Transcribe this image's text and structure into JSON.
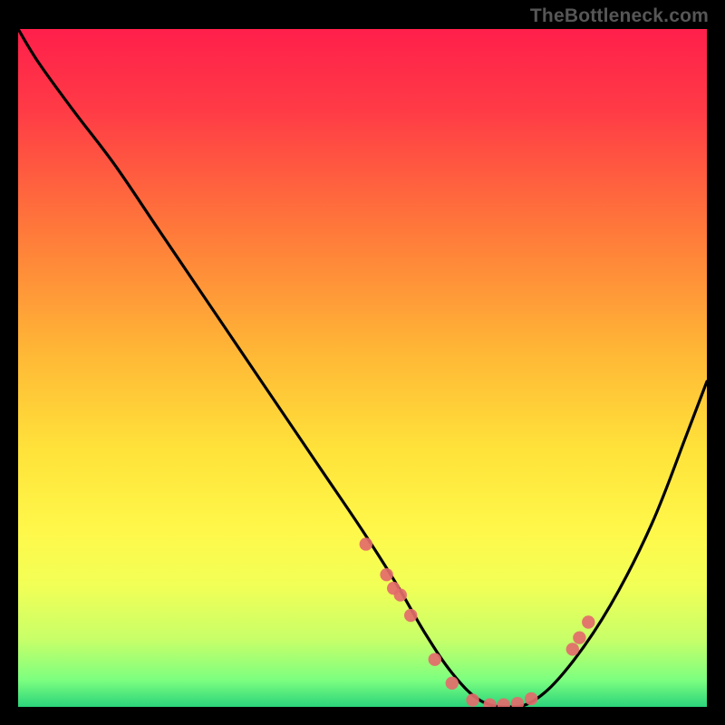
{
  "watermark": "TheBottleneck.com",
  "chart_data": {
    "type": "line",
    "title": "",
    "xlabel": "",
    "ylabel": "",
    "xlim": [
      0,
      100
    ],
    "ylim": [
      0,
      100
    ],
    "gradient_stops": [
      {
        "offset": 0.0,
        "color": "#ff1f4b"
      },
      {
        "offset": 0.12,
        "color": "#ff3b46"
      },
      {
        "offset": 0.3,
        "color": "#ff7a3a"
      },
      {
        "offset": 0.48,
        "color": "#ffb836"
      },
      {
        "offset": 0.62,
        "color": "#ffe23a"
      },
      {
        "offset": 0.74,
        "color": "#fff84a"
      },
      {
        "offset": 0.82,
        "color": "#f2ff56"
      },
      {
        "offset": 0.9,
        "color": "#c8ff68"
      },
      {
        "offset": 0.96,
        "color": "#7dff80"
      },
      {
        "offset": 1.0,
        "color": "#2bd47b"
      }
    ],
    "curve": {
      "x": [
        0,
        3,
        8,
        14,
        20,
        26,
        32,
        38,
        44,
        50,
        55,
        59,
        63,
        67,
        71,
        75,
        80,
        86,
        92,
        97,
        100
      ],
      "y": [
        100,
        95,
        88,
        80,
        71,
        62,
        53,
        44,
        35,
        26,
        18,
        11,
        5,
        1,
        0,
        1,
        6,
        15,
        27,
        40,
        48
      ]
    },
    "markers": {
      "x": [
        50.5,
        53.5,
        54.5,
        55.5,
        57.0,
        60.5,
        63.0,
        66.0,
        68.5,
        70.5,
        72.5,
        74.5,
        80.5,
        81.5,
        82.8
      ],
      "y": [
        24.0,
        19.5,
        17.5,
        16.5,
        13.5,
        7.0,
        3.5,
        1.0,
        0.3,
        0.3,
        0.5,
        1.2,
        8.5,
        10.2,
        12.5
      ]
    }
  }
}
